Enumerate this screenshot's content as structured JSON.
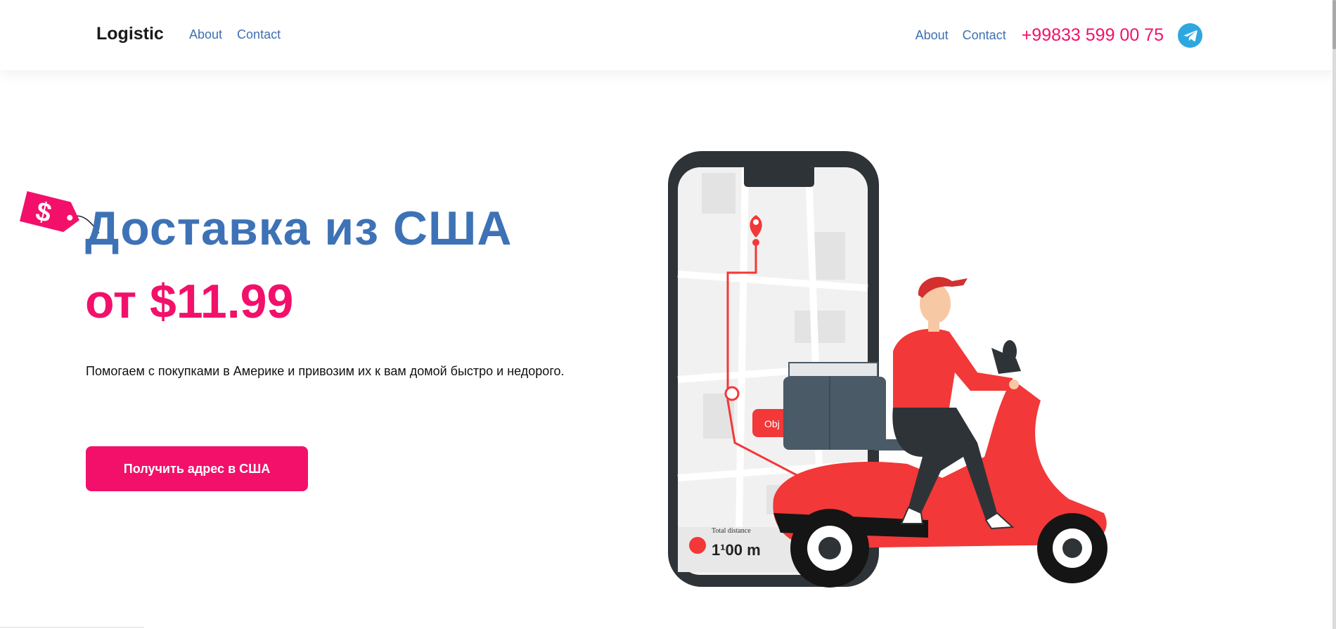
{
  "header": {
    "brand": "Logistic",
    "nav_left": [
      "About",
      "Contact"
    ],
    "nav_right": [
      "About",
      "Contact"
    ],
    "phone": "+99833 599 00 75",
    "telegram_icon": "telegram-icon"
  },
  "hero": {
    "title": "Доставка из США",
    "price": "от $11.99",
    "description": "Помогаем с покупками в Америке и привозим их к вам домой быстро и недорого.",
    "cta_label": "Получить адрес в США",
    "tag_symbol": "$"
  },
  "illustration": {
    "map_label": "Obj",
    "distance_caption": "Total distance",
    "distance_value": "1¹00 m"
  },
  "colors": {
    "accent": "#f2106b",
    "primary_blue": "#3e72b6",
    "scooter_red": "#f23838",
    "telegram": "#2ea7e0"
  }
}
